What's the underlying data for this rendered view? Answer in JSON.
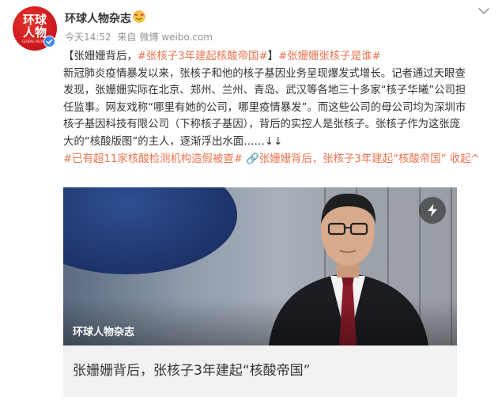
{
  "header": {
    "avatar_text_line1": "环球",
    "avatar_text_line2": "人物",
    "avatar_text_line3": "GLOBAL PEOPLE",
    "username": "环球人物杂志",
    "timestamp": "今天14:52",
    "source_prefix": "来自",
    "source": "微博 weibo.com",
    "badge_icon": "heart-eyes-emoji-icon",
    "verified_icon": "verified-check-icon",
    "more_icon": "chevron-down-icon"
  },
  "post": {
    "line1": [
      {
        "text": "【张姗姗背后，",
        "link": false
      },
      {
        "text": "#张核子3年建起核酸帝国#",
        "link": true
      },
      {
        "text": "】",
        "link": false
      },
      {
        "text": "#张姗姗张核子是谁#",
        "link": true
      }
    ],
    "line2": "新冠肺炎疫情暴发以来，张核子和他的核子基因业务呈现爆发式增长。记者通过天眼查",
    "line3": "发现，张姗姗实际在北京、郑州、兰州、青岛、武汉等各地三十多家“核子华曦”公司担",
    "line4": "任监事。网友戏称“哪里有她的公司，哪里疫情暴发”。而这些公司的母公司均为深圳市",
    "line5": "核子基因科技有限公司（下称核子基因），背后的实控人是张核子。张核子作为这张庞",
    "line6": "大的“核酸版图”的主人，逐渐浮出水面……↓↓",
    "line7": [
      {
        "text": "#已有超11家核酸检测机构造假被查#",
        "link": true
      },
      {
        "text": " 🔗张姗姗背后，张核子3年建起“核酸帝国”",
        "link": true
      },
      {
        "text": " 收起",
        "link": true
      },
      {
        "text": "^",
        "link": true
      }
    ]
  },
  "card": {
    "caption": "环球人物杂志",
    "title": "张姗姗背后，张核子3年建起“核酸帝国”",
    "flash_icon": "lightning-icon"
  },
  "colors": {
    "link": "#eb7350",
    "avatar_red": "#d41f1f",
    "verified_blue": "#3d87e6",
    "card_bg": "#f2f2f2"
  }
}
